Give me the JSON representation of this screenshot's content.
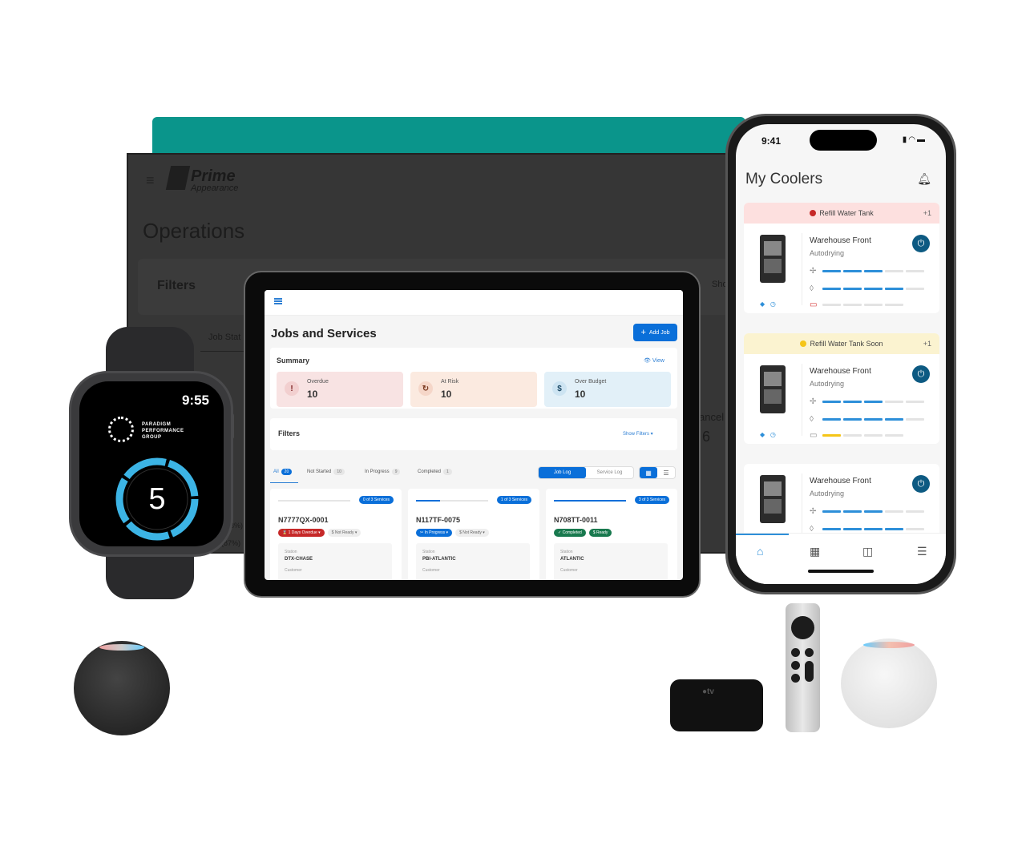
{
  "desktop": {
    "brand_name": "Prime",
    "brand_sub": "Appearance",
    "page_title": "Operations",
    "filters_label": "Filters",
    "show_filters_partial": "Sho",
    "job_status_partial": "Job Stat",
    "cancel_partial": "ancel",
    "cancel_value_partial": "6",
    "pct_1": "13%)",
    "pct_2": "(87%)",
    "accent_color": "#0a958b"
  },
  "tablet": {
    "page_title": "Jobs and Services",
    "add_job_label": "Add Job",
    "summary": {
      "title": "Summary",
      "view_label": "View",
      "stats": [
        {
          "label": "Overdue",
          "value": "10",
          "icon": "alert-circle-icon"
        },
        {
          "label": "At Risk",
          "value": "10",
          "icon": "clock-refresh-icon"
        },
        {
          "label": "Over Budget",
          "value": "10",
          "icon": "no-money-icon"
        }
      ]
    },
    "filters": {
      "title": "Filters",
      "show_label": "Show Filters"
    },
    "status_tabs": [
      {
        "label": "All",
        "count": "20"
      },
      {
        "label": "Not Started",
        "count": "10"
      },
      {
        "label": "In Progress",
        "count": "9"
      },
      {
        "label": "Completed",
        "count": "1"
      }
    ],
    "log_toggle": {
      "job_log": "Job Log",
      "service_log": "Service Log"
    },
    "jobs": [
      {
        "services": "0 of 3 Services",
        "progress": 0,
        "id": "N7777QX-0001",
        "status": "1 Days Overdue",
        "budget": "Not Ready",
        "station_label": "Station",
        "station": "DTX-CHASE",
        "customer_label": "Customer"
      },
      {
        "services": "1 of 3 Services",
        "progress": 0.33,
        "id": "N117TF-0075",
        "status": "In Progress",
        "budget": "Not Ready",
        "station_label": "Station",
        "station": "PBI-ATLANTIC",
        "customer_label": "Customer"
      },
      {
        "services": "3 of 3 Services",
        "progress": 1,
        "id": "N708TT-0011",
        "status": "Completed",
        "budget": "Ready",
        "station_label": "Station",
        "station": "ATLANTIC",
        "customer_label": "Customer"
      }
    ]
  },
  "watch": {
    "time": "9:55",
    "brand": [
      "PARADIGM",
      "PERFORMANCE",
      "GROUP"
    ],
    "value": "5"
  },
  "phone": {
    "time": "9:41",
    "title": "My Coolers",
    "coolers": [
      {
        "alert": "Refill Water Tank",
        "alert_extra": "+1",
        "alert_color": "#c62828",
        "alert_bg": "#fde0df",
        "name": "Warehouse Front",
        "mode": "Autodrying",
        "fan_level": 3,
        "humidity_level": 4,
        "tank_level": 0,
        "tank_color": "#d32f2f"
      },
      {
        "alert": "Refill Water Tank Soon",
        "alert_extra": "+1",
        "alert_color": "#f5c518",
        "alert_bg": "#fbf3d0",
        "name": "Warehouse Front",
        "mode": "Autodrying",
        "fan_level": 3,
        "humidity_level": 4,
        "tank_level": 1,
        "tank_color": "#f5c518"
      },
      {
        "name": "Warehouse Front",
        "mode": "Autodrying",
        "fan_level": 3,
        "humidity_level": 4
      }
    ],
    "nav": [
      "home-icon",
      "calendar-icon",
      "bag-icon",
      "menu-icon"
    ]
  },
  "devices": {
    "apple_tv_label": "tv"
  }
}
